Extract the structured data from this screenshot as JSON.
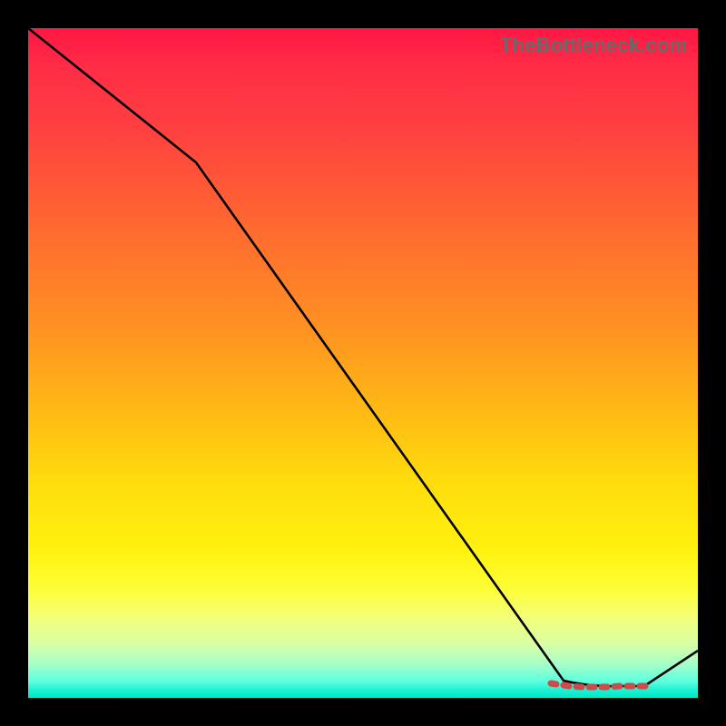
{
  "watermark": "TheBottleneck.com",
  "chart_data": {
    "type": "line",
    "title": "",
    "xlabel": "",
    "ylabel": "",
    "xlim": [
      0,
      100
    ],
    "ylim": [
      0,
      100
    ],
    "grid": false,
    "series": [
      {
        "name": "curve",
        "color": "#000000",
        "x": [
          0,
          25,
          80,
          85,
          92,
          100
        ],
        "values": [
          100,
          80,
          2.5,
          1.8,
          1.8,
          7
        ]
      },
      {
        "name": "optimal-range-markers",
        "color": "#cc4b4b",
        "x": [
          78,
          80,
          82,
          84,
          86,
          88,
          90,
          92
        ],
        "values": [
          2.2,
          2.0,
          1.9,
          1.8,
          1.8,
          1.8,
          1.8,
          1.8
        ]
      }
    ],
    "background_gradient": {
      "top": "#ff1744",
      "upper_mid": "#ffb300",
      "mid": "#ffee00",
      "lower_mid": "#ccff66",
      "bottom": "#00e8c8"
    }
  }
}
